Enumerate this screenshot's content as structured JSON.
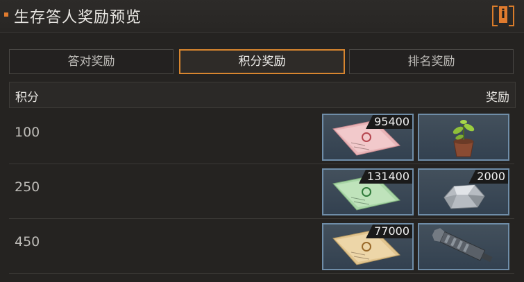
{
  "header": {
    "title": "生存答人奖励预览",
    "info_label": "i"
  },
  "tabs": [
    {
      "label": "答对奖励",
      "active": false
    },
    {
      "label": "积分奖励",
      "active": true
    },
    {
      "label": "排名奖励",
      "active": false
    }
  ],
  "table": {
    "col_score": "积分",
    "col_reward": "奖励",
    "rows": [
      {
        "score": "100",
        "rewards": [
          {
            "icon": "pink-certificate-icon",
            "count": "95400"
          },
          {
            "icon": "potted-plant-icon",
            "count": ""
          }
        ]
      },
      {
        "score": "250",
        "rewards": [
          {
            "icon": "green-certificate-icon",
            "count": "131400"
          },
          {
            "icon": "metal-ore-icon",
            "count": "2000"
          }
        ]
      },
      {
        "score": "450",
        "rewards": [
          {
            "icon": "yellow-certificate-icon",
            "count": "77000"
          },
          {
            "icon": "gun-part-icon",
            "count": ""
          }
        ]
      }
    ]
  },
  "colors": {
    "accent": "#e07b2e",
    "slot_border": "#6f8da8",
    "background": "#252321"
  }
}
